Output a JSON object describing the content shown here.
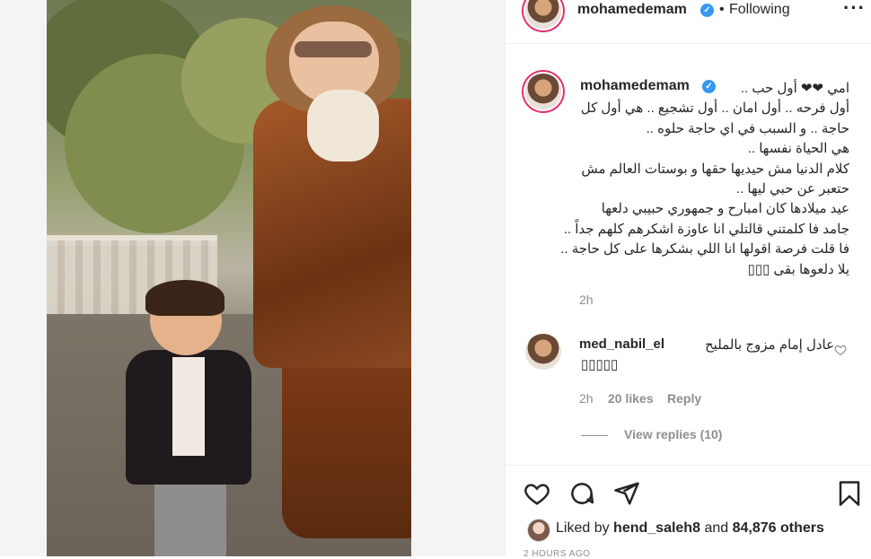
{
  "header": {
    "username": "mohamedemam",
    "separator": "•",
    "follow_status": "Following",
    "more_icon": "more-horizontal-icon"
  },
  "caption": {
    "username": "mohamedemam",
    "lines": [
      "امي ❤❤ أول حب ..",
      "أول فرحه .. أول امان .. أول تشجيع .. هي أول كل",
      "حاجة .. و السبب في اي حاجة حلوه ..",
      "هي الحياة نفسها ..",
      "كلام الدنيا مش حيديها حقها و بوستات العالم مش",
      "حتعبر عن حبي ليها ..",
      "عيد ميلادها كان امبارح و جمهوري حبيبي دلعها",
      "جامد فا كلمتني قالتلي انا عاوزة اشكرهم كلهم جداً ..",
      "فا قلت فرصة اقولها انا اللي بشكرها على كل حاجة ..",
      "يلا دلعوها بقى ▯▯▯"
    ],
    "time": "2h"
  },
  "comment": {
    "username": "med_nabil_el",
    "text": "عادل إمام مزوج بالمليح",
    "emoji_line": "▯▯▯▯▯",
    "time": "2h",
    "likes": "20 likes",
    "reply": "Reply",
    "view_replies": "View replies (10)"
  },
  "actions": {
    "like_icon": "heart-icon",
    "comment_icon": "comment-icon",
    "share_icon": "send-icon",
    "save_icon": "bookmark-icon"
  },
  "likes": {
    "prefix": "Liked by",
    "user": "hend_saleh8",
    "middle": "and",
    "count": "84,876 others"
  },
  "timestamp": "2 HOURS AGO",
  "colors": {
    "verified": "#3897f0",
    "story_ring": "#e1306c",
    "secondary_text": "#8e8e8e"
  }
}
